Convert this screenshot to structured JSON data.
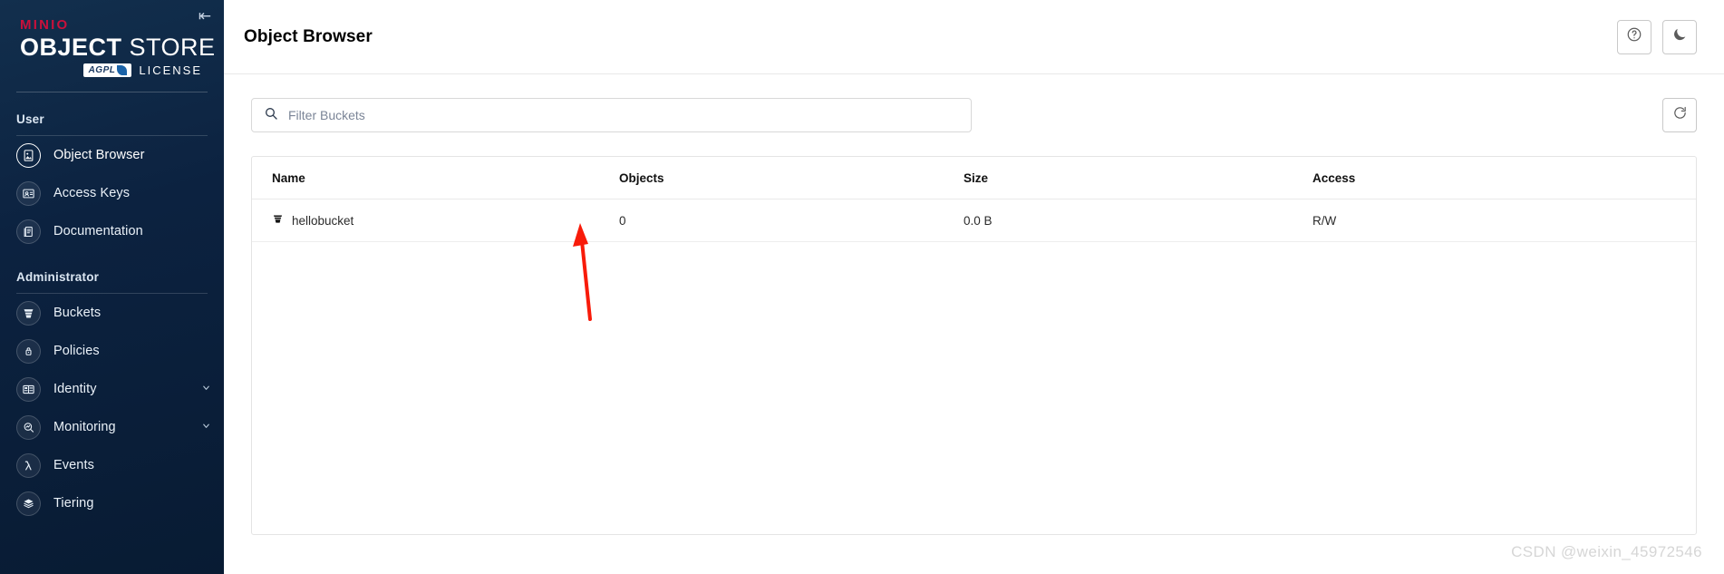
{
  "sidebar": {
    "collapse_icon": "collapse-left-icon",
    "logo": {
      "brand": "MINIO",
      "title_bold": "OBJECT",
      "title_light": "STORE",
      "badge": "AGPL",
      "license": "LICENSE"
    },
    "sections": [
      {
        "label": "User",
        "items": [
          {
            "label": "Object Browser",
            "icon": "object-browser-icon",
            "selected": true,
            "chevron": ""
          },
          {
            "label": "Access Keys",
            "icon": "access-keys-icon",
            "selected": false,
            "chevron": ""
          },
          {
            "label": "Documentation",
            "icon": "documentation-icon",
            "selected": false,
            "chevron": ""
          }
        ]
      },
      {
        "label": "Administrator",
        "items": [
          {
            "label": "Buckets",
            "icon": "bucket-icon",
            "selected": false,
            "chevron": ""
          },
          {
            "label": "Policies",
            "icon": "policies-icon",
            "selected": false,
            "chevron": ""
          },
          {
            "label": "Identity",
            "icon": "identity-icon",
            "selected": false,
            "chevron": "ˇ"
          },
          {
            "label": "Monitoring",
            "icon": "monitoring-icon",
            "selected": false,
            "chevron": "ˇ"
          },
          {
            "label": "Events",
            "icon": "events-icon",
            "selected": false,
            "chevron": ""
          },
          {
            "label": "Tiering",
            "icon": "tiering-icon",
            "selected": false,
            "chevron": ""
          }
        ]
      }
    ]
  },
  "header": {
    "title": "Object Browser",
    "help_icon": "help-circle-icon",
    "dark_mode_icon": "moon-icon"
  },
  "toolbar": {
    "search_placeholder": "Filter Buckets",
    "search_value": "",
    "search_icon": "search-icon",
    "refresh_icon": "refresh-icon"
  },
  "table": {
    "columns": [
      "Name",
      "Objects",
      "Size",
      "Access"
    ],
    "rows": [
      {
        "name": "hellobucket",
        "objects": "0",
        "size": "0.0 B",
        "access": "R/W"
      }
    ]
  },
  "annotation": {
    "arrow_color": "#f81b0a",
    "points_at": "hellobucket"
  },
  "watermark": "CSDN @weixin_45972546"
}
